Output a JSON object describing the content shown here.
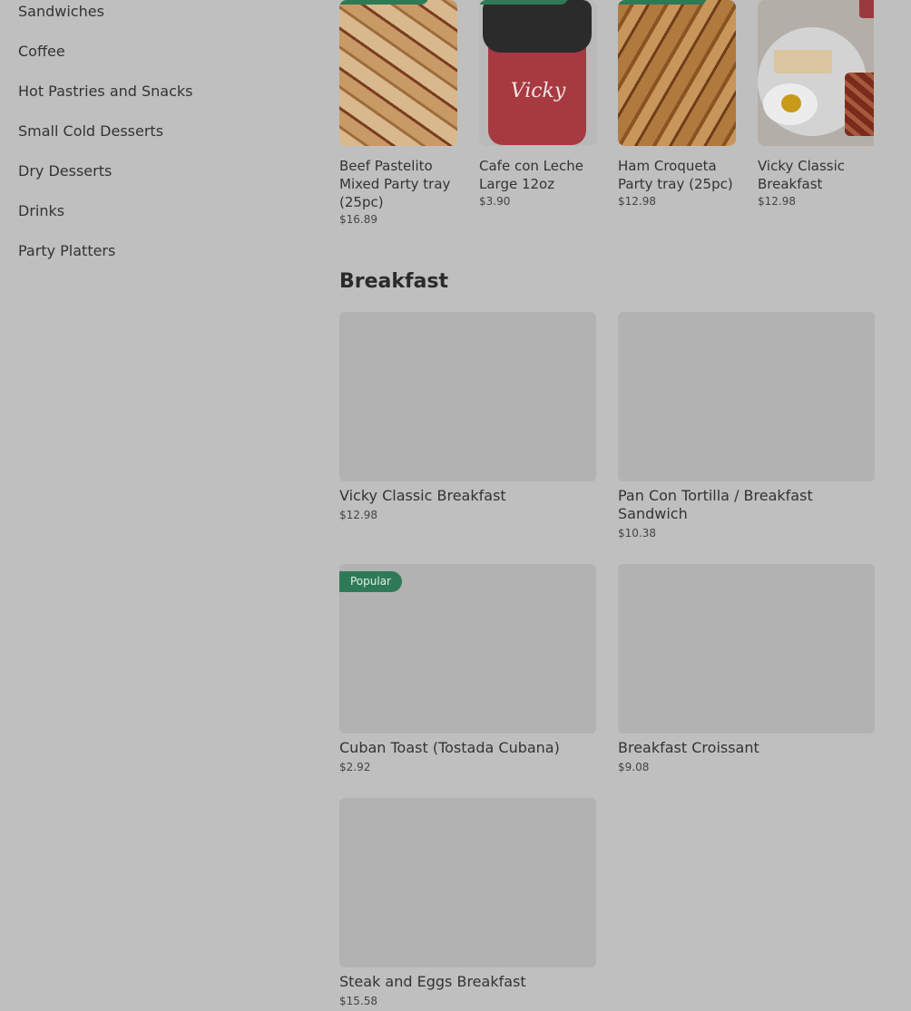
{
  "sidebar": {
    "items": [
      {
        "label": "Sandwiches"
      },
      {
        "label": "Coffee"
      },
      {
        "label": "Hot Pastries and Snacks"
      },
      {
        "label": "Small Cold Desserts"
      },
      {
        "label": "Dry Desserts"
      },
      {
        "label": "Drinks"
      },
      {
        "label": "Party Platters"
      }
    ]
  },
  "featured": {
    "items": [
      {
        "title": "Beef Pastelito Mixed Party tray (25pc)",
        "price": "$16.89",
        "image": "pastries-tray-photo"
      },
      {
        "title": "Cafe con Leche Large 12oz",
        "price": "$3.90",
        "image": "coffee-cup-photo",
        "logo_text": "Vicky"
      },
      {
        "title": "Ham Croqueta Party tray (25pc)",
        "price": "$12.98",
        "image": "croquetas-tray-photo"
      },
      {
        "title": "Vicky Classic Breakfast",
        "price": "$12.98",
        "image": "breakfast-plate-photo"
      }
    ]
  },
  "breakfast": {
    "title": "Breakfast",
    "items": [
      {
        "title": "Vicky Classic Breakfast",
        "price": "$12.98"
      },
      {
        "title": "Pan Con Tortilla / Breakfast Sandwich",
        "price": "$10.38"
      },
      {
        "title": "Cuban Toast (Tostada Cubana)",
        "price": "$2.92",
        "badge": "Popular"
      },
      {
        "title": "Breakfast Croissant",
        "price": "$9.08"
      },
      {
        "title": "Steak and Eggs Breakfast",
        "price": "$15.58"
      }
    ]
  },
  "colors": {
    "overlay_bg": "#bfbfbf",
    "badge_green": "#2f7a56",
    "placeholder_gray": "#b2b2b2"
  }
}
